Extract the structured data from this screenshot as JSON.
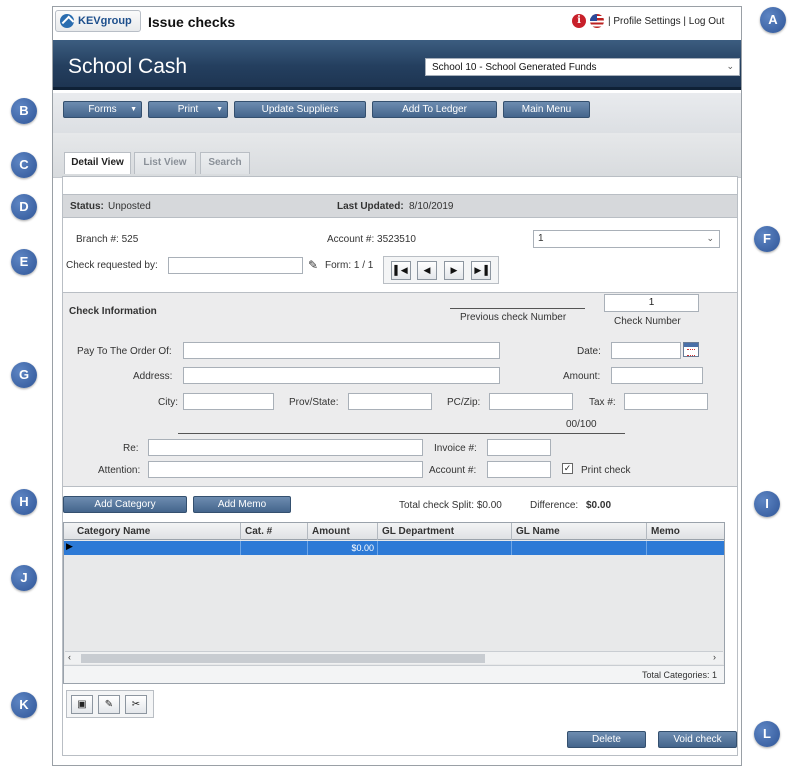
{
  "header": {
    "logo_text": "KEVgroup",
    "page_heading": "Issue checks",
    "links": "| Profile Settings | Log Out"
  },
  "banner": {
    "app_title": "School Cash",
    "school_selected": "School 10 - School Generated Funds"
  },
  "toolbar": {
    "forms": "Forms",
    "print": "Print",
    "update_suppliers": "Update Suppliers",
    "add_to_ledger": "Add To Ledger",
    "main_menu": "Main Menu"
  },
  "tabs": {
    "detail": "Detail View",
    "list": "List View",
    "search": "Search"
  },
  "status": {
    "status_label": "Status:",
    "status_value": "Unposted",
    "updated_label": "Last Updated:",
    "updated_value": "8/10/2019"
  },
  "account_info": {
    "branch": "Branch #: 525",
    "account": "Account #: 3523510",
    "selector_value": "1",
    "requested_by_label": "Check requested by:",
    "requested_by_value": "",
    "form_label": "Form: 1 / 1"
  },
  "check_info": {
    "title": "Check Information",
    "previous_check_label": "Previous check Number",
    "check_number_value": "1",
    "check_number_label": "Check Number",
    "pay_to_label": "Pay To The Order Of:",
    "address_label": "Address:",
    "date_label": "Date:",
    "amount_label": "Amount:",
    "city_label": "City:",
    "prov_label": "Prov/State:",
    "zip_label": "PC/Zip:",
    "tax_label": "Tax #:",
    "amount_words": "00/100",
    "re_label": "Re:",
    "invoice_label": "Invoice #:",
    "attention_label": "Attention:",
    "account_label": "Account #:",
    "print_check_label": "Print check",
    "print_check_checked": true
  },
  "split": {
    "add_category": "Add Category",
    "add_memo": "Add Memo",
    "total_split": "Total check Split: $0.00",
    "difference_label": "Difference:",
    "difference_value": "$0.00"
  },
  "grid": {
    "columns": [
      "Category Name",
      "Cat. #",
      "Amount",
      "GL Department",
      "GL Name",
      "Memo"
    ],
    "rows": [
      [
        "",
        "",
        "$0.00",
        "",
        "",
        ""
      ]
    ],
    "footer": "Total Categories: 1"
  },
  "actions": {
    "delete": "Delete",
    "void_check": "Void check"
  },
  "markers": [
    "A",
    "B",
    "C",
    "D",
    "E",
    "F",
    "G",
    "H",
    "I",
    "J",
    "K",
    "L"
  ]
}
